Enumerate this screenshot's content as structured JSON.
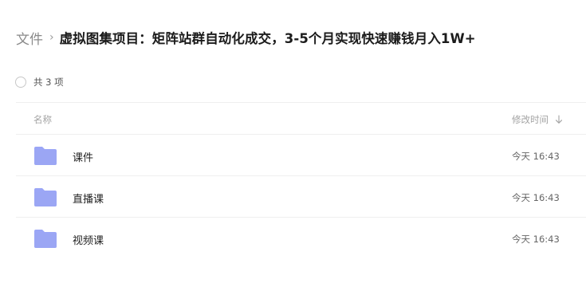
{
  "breadcrumb": {
    "root": "文件",
    "separator": "›",
    "current": "虚拟图集项目：矩阵站群自动化成交，3-5个月实现快速赚钱月入1W+"
  },
  "summary": {
    "count_text": "共 3 项"
  },
  "table": {
    "columns": {
      "name": "名称",
      "modified": "修改时间"
    },
    "sort_icon": "arrow-down-icon",
    "rows": [
      {
        "name": "课件",
        "time": "今天 16:43",
        "icon": "folder-icon"
      },
      {
        "name": "直播课",
        "time": "今天 16:43",
        "icon": "folder-icon"
      },
      {
        "name": "视频课",
        "time": "今天 16:43",
        "icon": "folder-icon"
      }
    ]
  },
  "colors": {
    "folder": "#8c98f2",
    "folder_light": "#b7c0fa",
    "divider": "#efefef"
  }
}
